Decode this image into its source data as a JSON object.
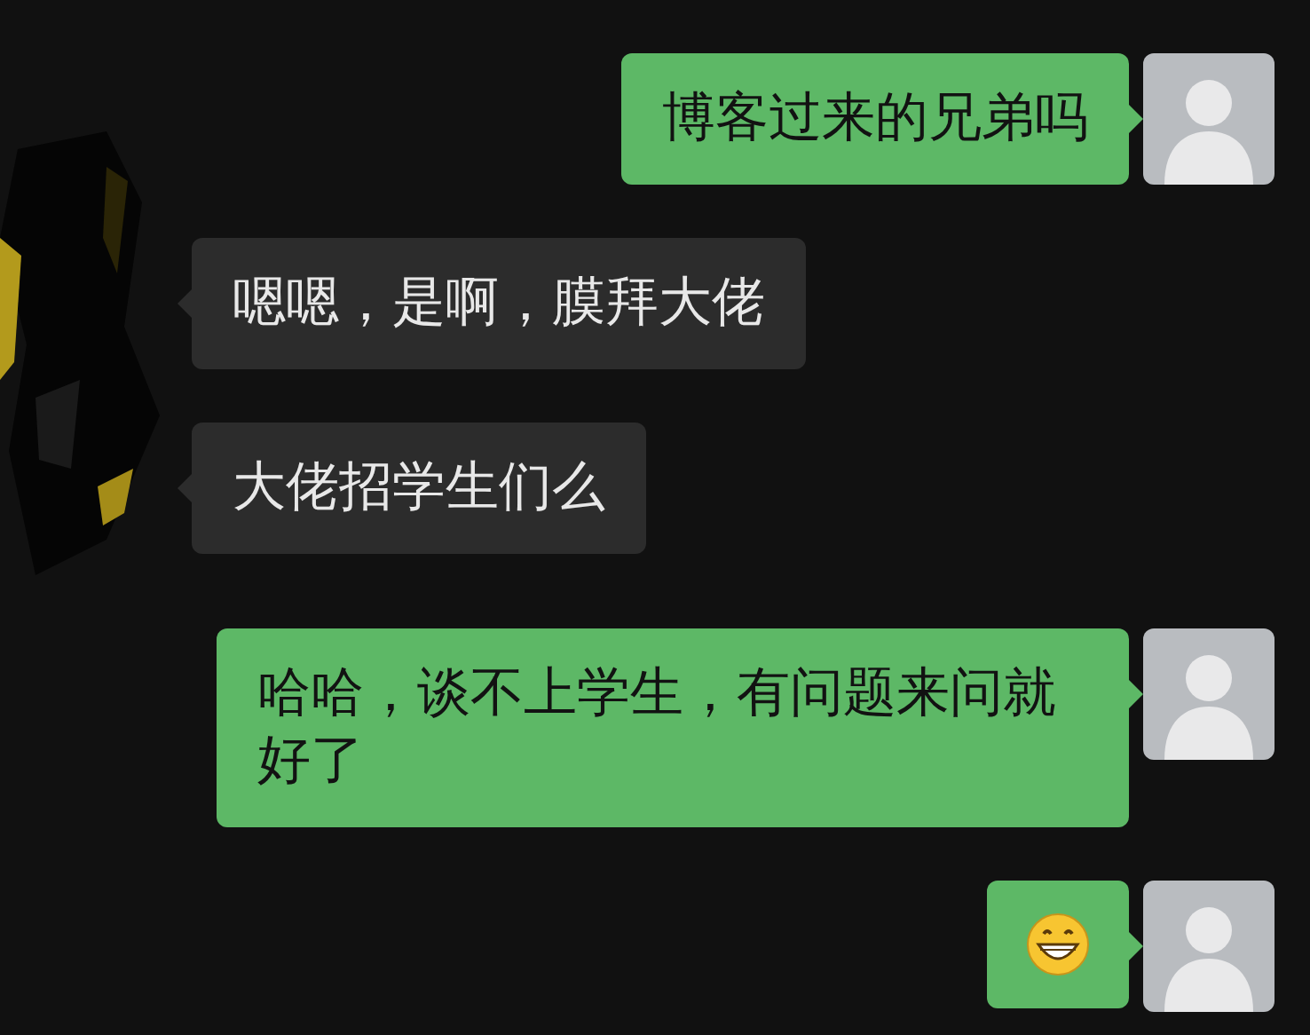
{
  "messages": [
    {
      "mine": true,
      "kind": "text",
      "text": "博客过来的兄弟吗"
    },
    {
      "mine": false,
      "kind": "text",
      "text": "嗯嗯，是啊，膜拜大佬"
    },
    {
      "mine": false,
      "kind": "text",
      "text": "大佬招学生们么"
    },
    {
      "mine": true,
      "kind": "text",
      "text": "哈哈，谈不上学生，有问题来问就好了"
    },
    {
      "mine": true,
      "kind": "emoji"
    }
  ]
}
